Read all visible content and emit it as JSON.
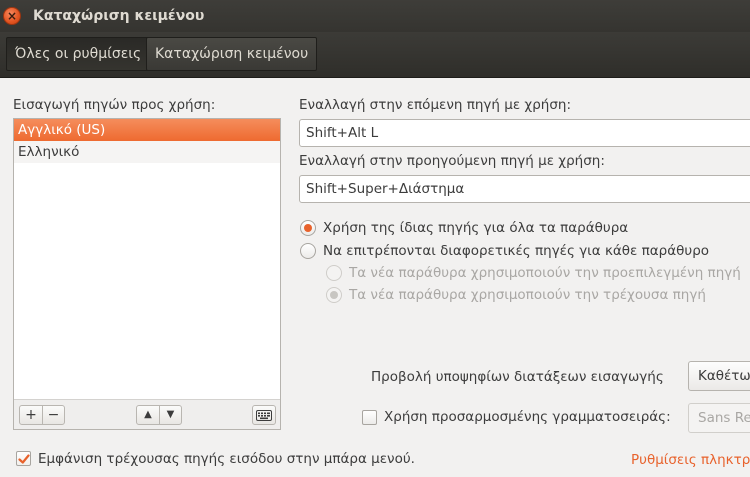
{
  "window": {
    "title": "Καταχώριση κειμένου"
  },
  "breadcrumb": {
    "all_settings": "Όλες οι ρυθμίσεις",
    "current": "Καταχώριση κειμένου"
  },
  "sources": {
    "label": "Εισαγωγή πηγών προς χρήση:",
    "items": [
      {
        "label": "Αγγλικό (US)",
        "selected": true
      },
      {
        "label": "Ελληνικό",
        "selected": false
      }
    ],
    "add_label": "+",
    "remove_label": "−",
    "up_label": "▲",
    "down_label": "▼"
  },
  "switching": {
    "next_label": "Εναλλαγή στην επόμενη πηγή με χρήση:",
    "next_value": "Shift+Alt L",
    "prev_label": "Εναλλαγή στην προηγούμενη πηγή με χρήση:",
    "prev_value": "Shift+Super+Διάστημα"
  },
  "scope": {
    "same_all": "Χρήση της ίδιας πηγής για όλα τα παράθυρα",
    "per_window": "Να επιτρέπονται διαφορετικές πηγές για κάθε παράθυρο",
    "new_default": "Τα νέα παράθυρα χρησιμοποιούν την προεπιλεγμένη πηγή",
    "new_current": "Τα νέα παράθυρα χρησιμοποιούν την τρέχουσα πηγή"
  },
  "candidates": {
    "label": "Προβολή υποψηφίων διατάξεων εισαγωγής",
    "value": "Καθέτω"
  },
  "custom_font": {
    "label": "Χρήση προσαρμοσμένης γραμματοσειράς:",
    "value": "Sans Re",
    "checked": false
  },
  "show_current": {
    "label": "Εμφάνιση τρέχουσας πηγής εισόδου στην μπάρα μενού.",
    "checked": true
  },
  "keyboard_link": "Ρυθμίσεις πληκτρ",
  "colors": {
    "accent": "#e8622c",
    "selection": "#f07746",
    "titlebar": "#3c3b37"
  }
}
